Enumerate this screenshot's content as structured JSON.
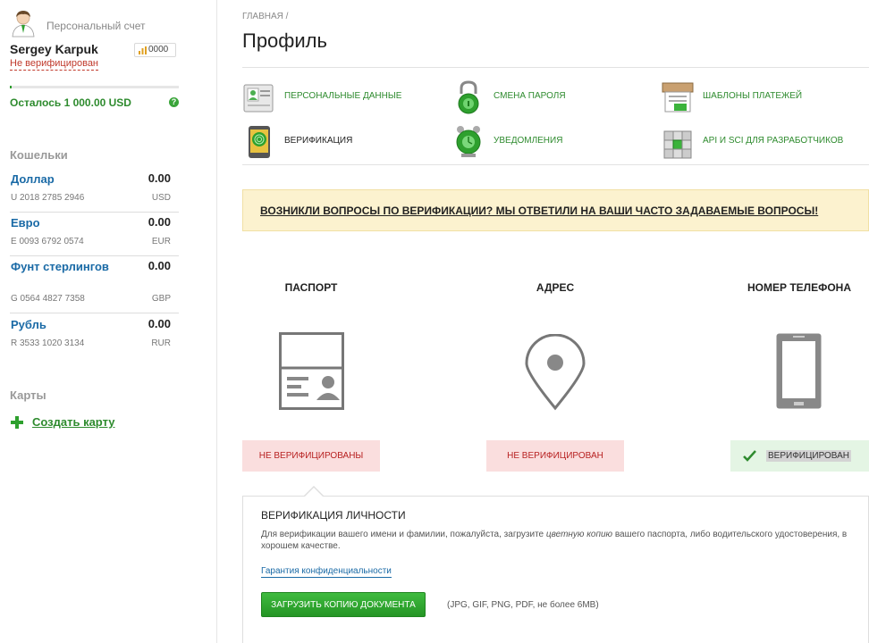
{
  "sidebar": {
    "account_title": "Персональный счет",
    "user_name": "Sergey Karpuk",
    "rating": "0000",
    "verification_status": "Не верифицирован",
    "balance_progress": 0.01,
    "remaining_label": "Осталось 1 000.00 USD",
    "help_icon_label": "?",
    "wallets_title": "Кошельки",
    "wallets": [
      {
        "name": "Доллар",
        "number": "U 2018 2785 2946",
        "amount": "0.00",
        "currency": "USD"
      },
      {
        "name": "Евро",
        "number": "E 0093 6792 0574",
        "amount": "0.00",
        "currency": "EUR"
      },
      {
        "name": "Фунт стерлингов",
        "number": "G 0564 4827 7358",
        "amount": "0.00",
        "currency": "GBP"
      },
      {
        "name": "Рубль",
        "number": "R 3533 1020 3134",
        "amount": "0.00",
        "currency": "RUR"
      }
    ],
    "cards_title": "Карты",
    "create_card_label": "Создать карту"
  },
  "main": {
    "breadcrumb": "ГЛАВНАЯ /",
    "page_title": "Профиль",
    "menu": [
      {
        "label": "ПЕРСОНАЛЬНЫЕ ДАННЫЕ",
        "icon": "id-card-icon"
      },
      {
        "label": "СМЕНА ПАРОЛЯ",
        "icon": "padlock-icon"
      },
      {
        "label": "ШАБЛОНЫ ПЛАТЕЖЕЙ",
        "icon": "payment-templates-icon"
      },
      {
        "label": "ВЕРИФИКАЦИЯ",
        "icon": "fingerprint-phone-icon"
      },
      {
        "label": "УВЕДОМЛЕНИЯ",
        "icon": "alarm-clock-icon"
      },
      {
        "label": "API И SCI ДЛЯ РАЗРАБОТЧИКОВ",
        "icon": "api-cubes-icon"
      }
    ],
    "notice": "ВОЗНИКЛИ ВОПРОСЫ ПО ВЕРИФИКАЦИИ? МЫ ОТВЕТИЛИ НА ВАШИ ЧАСТО ЗАДАВАЕМЫЕ ВОПРОСЫ!",
    "verification": [
      {
        "title": "ПАСПОРТ",
        "status": "НЕ ВЕРИФИЦИРОВАНЫ",
        "verified": false
      },
      {
        "title": "АДРЕС",
        "status": "НЕ ВЕРИФИЦИРОВАН",
        "verified": false
      },
      {
        "title": "НОМЕР ТЕЛЕФОНА",
        "status": "ВЕРИФИЦИРОВАН",
        "verified": true
      }
    ],
    "panel": {
      "title": "ВЕРИФИКАЦИЯ ЛИЧНОСТИ",
      "text_before": "Для верификации вашего имени и фамилии, пожалуйста, загрузите ",
      "text_emphasis": "цветную копию",
      "text_after": " вашего паспорта, либо водительского удостоверения, в хорошем качестве.",
      "privacy_link": "Гарантия конфиденциальности",
      "upload_button": "ЗАГРУЗИТЬ КОПИЮ ДОКУМЕНТА",
      "formats": "(JPG, GIF, PNG, PDF, не более 6MB)"
    }
  },
  "colors": {
    "accent_green": "#2e8b2e",
    "link_blue": "#1a6aa6",
    "error_red": "#b82222",
    "notice_bg": "#fcf2cf"
  }
}
